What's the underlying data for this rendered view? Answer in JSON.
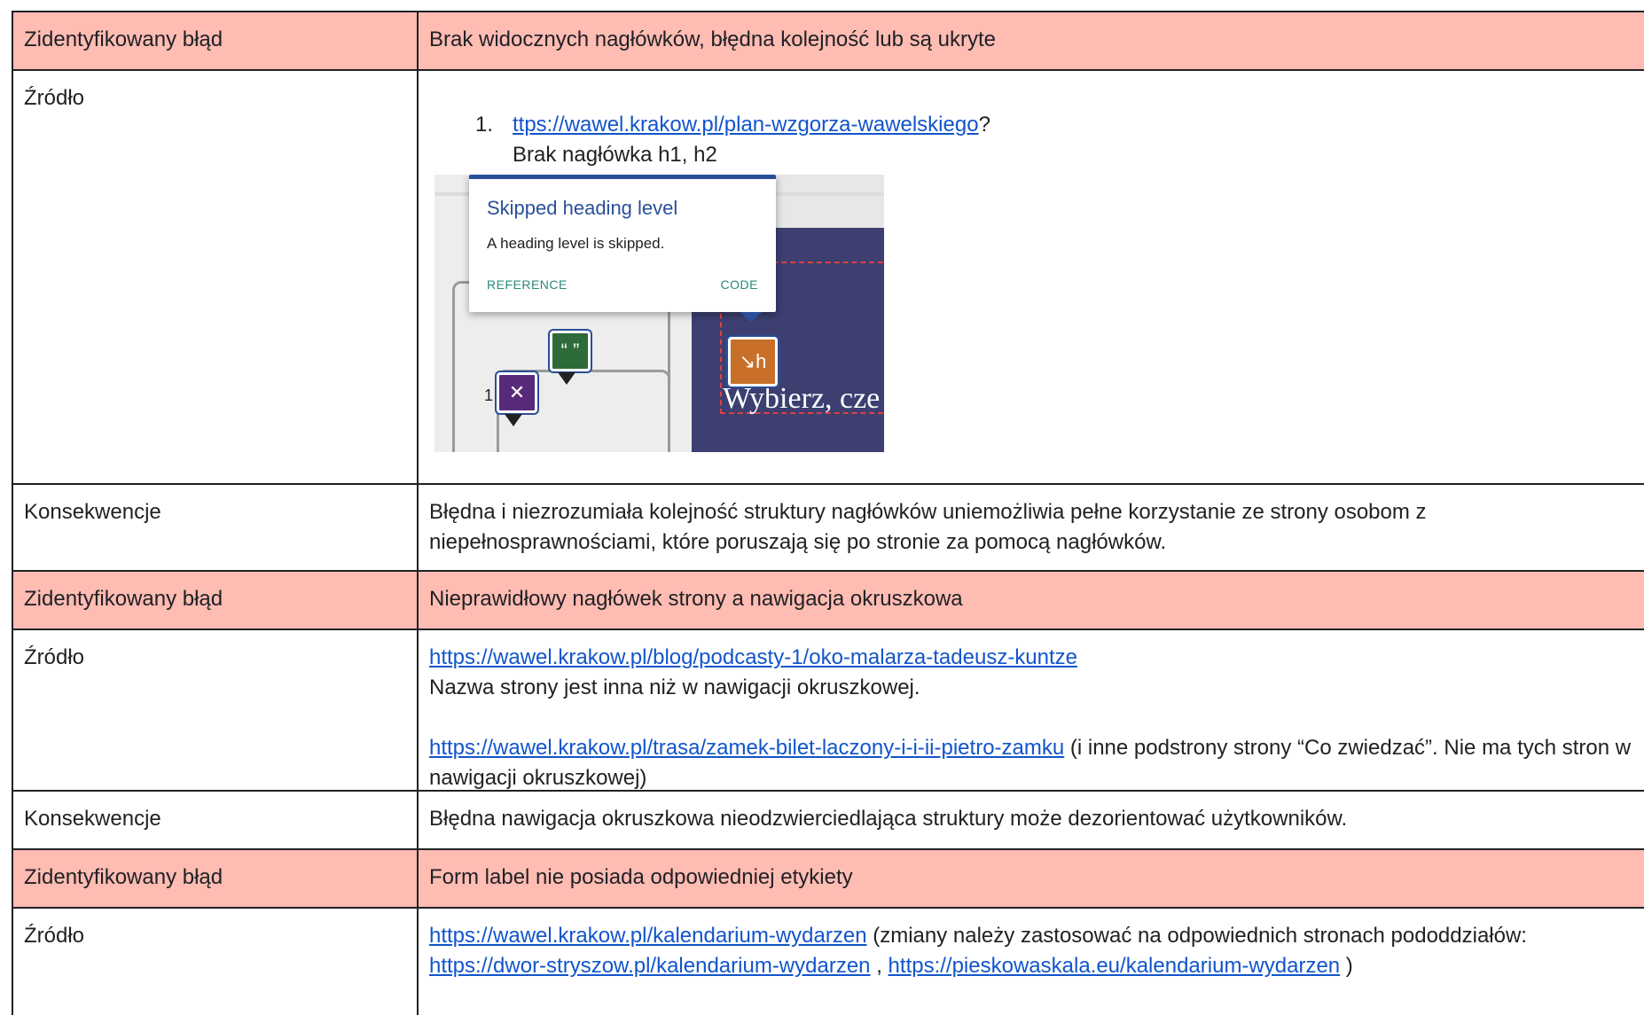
{
  "rows": [
    {
      "label": "Zidentyfikowany błąd",
      "text": "Brak widocznych nagłówków, błędna kolejność lub są ukryte"
    },
    {
      "label": "Źródło",
      "list_number": "1.",
      "link": "ttps://wawel.krakow.pl/plan-wzgorza-wawelskiego",
      "link_suffix": "?",
      "note": "Brak nagłówka h1, h2",
      "screenshot": {
        "popup_title": "Skipped heading level",
        "popup_desc": "A heading level is skipped.",
        "popup_link_reference": "REFERENCE",
        "popup_link_code": "CODE",
        "heading_text": "Wybierz, cze",
        "marker_label": "1"
      }
    },
    {
      "label": "Konsekwencje",
      "text": "Błędna i niezrozumiała kolejność struktury nagłówków uniemożliwia pełne korzystanie ze strony osobom z niepełnosprawnościami, które poruszają się po stronie za pomocą nagłówków."
    },
    {
      "label": "Zidentyfikowany błąd",
      "text": "Nieprawidłowy nagłówek strony a nawigacja okruszkowa"
    },
    {
      "label": "Źródło",
      "link1": "https://wawel.krakow.pl/blog/podcasty-1/oko-malarza-tadeusz-kuntze",
      "text1": "Nazwa strony jest inna niż w nawigacji okruszkowej.",
      "link2": "https://wawel.krakow.pl/trasa/zamek-bilet-laczony-i-i-ii-pietro-zamku",
      "text2": " (i inne podstrony strony “Co zwiedzać”. Nie ma tych stron w nawigacji okruszkowej)"
    },
    {
      "label": "Konsekwencje",
      "text": "Błędna nawigacja okruszkowa nieodzwierciedlająca struktury może dezorientować użytkowników."
    },
    {
      "label": "Zidentyfikowany błąd",
      "text": "Form label nie posiada odpowiedniej etykiety"
    },
    {
      "label": "Źródło",
      "link1": "https://wawel.krakow.pl/kalendarium-wydarzen",
      "text1": " (zmiany należy zastosować na odpowiednich stronach pododdziałów:",
      "link2": "https://dwor-stryszow.pl/kalendarium-wydarzen",
      "sep": " , ",
      "link3": "https://pieskowaskala.eu/kalendarium-wydarzen",
      "text3": " )"
    }
  ],
  "colors": {
    "highlight": "#ffbcb3",
    "link": "#1155cc",
    "border": "#202124"
  }
}
